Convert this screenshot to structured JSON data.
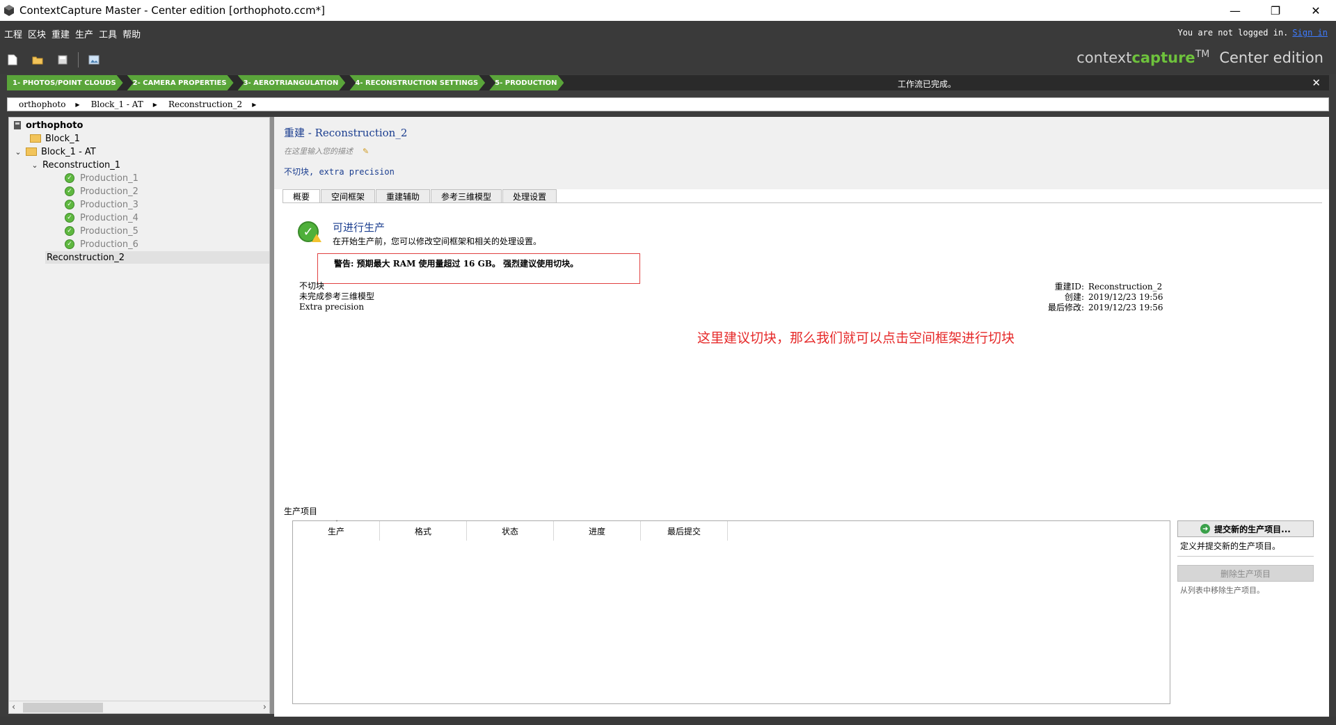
{
  "window": {
    "title": "ContextCapture Master - Center edition [orthophoto.ccm*]",
    "minimize": "—",
    "restore": "❐",
    "close": "✕"
  },
  "menu": {
    "items": [
      "工程",
      "区块",
      "重建",
      "生产",
      "工具",
      "帮助"
    ],
    "login_text": "You are not logged in.",
    "sign_in": "Sign in"
  },
  "brand": {
    "part1": "context",
    "part2": "capture",
    "tm": "TM",
    "edition": "Center edition"
  },
  "workflow": {
    "steps": [
      "1- PHOTOS/POINT CLOUDS",
      "2- CAMERA PROPERTIES",
      "3- AEROTRIANGULATION",
      "4- RECONSTRUCTION SETTINGS",
      "5- PRODUCTION"
    ],
    "status": "工作流已完成。",
    "close": "✕",
    "step_color": "#5aa53a"
  },
  "breadcrumb": [
    "orthophoto",
    "Block_1 - AT",
    "Reconstruction_2"
  ],
  "tree": {
    "root": "orthophoto",
    "block1": "Block_1",
    "block1_at": "Block_1 - AT",
    "recon1": "Reconstruction_1",
    "productions": [
      "Production_1",
      "Production_2",
      "Production_3",
      "Production_4",
      "Production_5",
      "Production_6"
    ],
    "recon2": "Reconstruction_2"
  },
  "main": {
    "title": "重建 - Reconstruction_2",
    "description_placeholder": "在这里输入您的描述",
    "subtitle": "不切块, extra precision",
    "tabs": [
      "概要",
      "空间框架",
      "重建辅助",
      "参考三维模型",
      "处理设置"
    ],
    "active_tab": "概要",
    "ready_title": "可进行生产",
    "ready_desc": "在开始生产前，您可以修改空间框架和相关的处理设置。",
    "warning": "警告: 预期最大 RAM 使用量超过 16 GB。 强烈建议使用切块。",
    "info_left": [
      "不切块",
      "未完成参考三维模型",
      "Extra precision"
    ],
    "info_right": {
      "id_label": "重建ID:",
      "id_value": "Reconstruction_2",
      "created_label": "创建:",
      "created_value": "2019/12/23 19:56",
      "modified_label": "最后修改:",
      "modified_value": "2019/12/23 19:56"
    },
    "annotation": "这里建议切块，那么我们就可以点击空间框架进行切块"
  },
  "production": {
    "section_label": "生产项目",
    "columns": [
      "生产",
      "格式",
      "状态",
      "进度",
      "最后提交"
    ],
    "submit_label": "提交新的生产项目...",
    "submit_desc": "定义并提交新的生产项目。",
    "delete_label": "删除生产项目",
    "delete_desc": "从列表中移除生产项目。"
  },
  "colors": {
    "accent_green": "#5aa53a",
    "title_blue": "#1a3d8f",
    "annotation_red": "#e62a2a",
    "warning_border": "#e04040"
  }
}
